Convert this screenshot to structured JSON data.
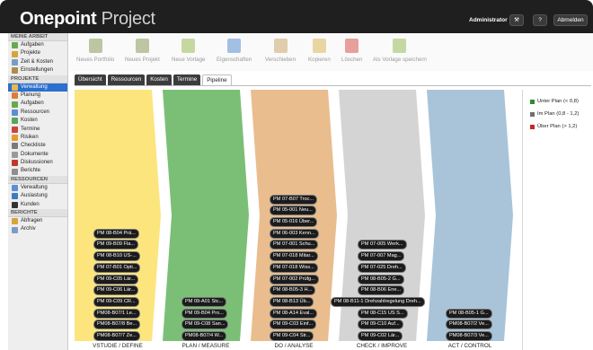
{
  "header": {
    "logo_bold": "Onepoint",
    "logo_light": " Project",
    "user": "Administrator",
    "btn_tools": "⚒",
    "btn_help": "?",
    "btn_logout": "Abmelden"
  },
  "sidebar": {
    "sections": [
      {
        "title": "MEINE ARBEIT",
        "items": [
          {
            "label": "Aufgaben",
            "icon": "tasks-icon",
            "color": "#6aa84f"
          },
          {
            "label": "Projekte",
            "icon": "projects-icon",
            "color": "#d8a43a"
          },
          {
            "label": "Zeit & Kosten",
            "icon": "time-costs-icon",
            "color": "#7a9cc6"
          },
          {
            "label": "Einstellungen",
            "icon": "settings-icon",
            "color": "#b08b4f"
          }
        ]
      },
      {
        "title": "PROJEKTE",
        "items": [
          {
            "label": "Verwaltung",
            "icon": "admin-icon",
            "color": "#e9b949",
            "active": true
          },
          {
            "label": "Planung",
            "icon": "planning-icon",
            "color": "#e07b39"
          },
          {
            "label": "Aufgaben",
            "icon": "tasks-icon",
            "color": "#6aa84f"
          },
          {
            "label": "Ressourcen",
            "icon": "resources-icon",
            "color": "#5b8fd1"
          },
          {
            "label": "Kosten",
            "icon": "costs-icon",
            "color": "#58a55c"
          },
          {
            "label": "Termine",
            "icon": "calendar-icon",
            "color": "#c9463d"
          },
          {
            "label": "Risiken",
            "icon": "risks-icon",
            "color": "#e59a2f"
          },
          {
            "label": "Checkliste",
            "icon": "checklist-icon",
            "color": "#7a7a7a"
          },
          {
            "label": "Dokumente",
            "icon": "documents-icon",
            "color": "#9a9a9a"
          },
          {
            "label": "Diskussionen",
            "icon": "discussions-icon",
            "color": "#c0392b"
          },
          {
            "label": "Berichte",
            "icon": "reports-icon",
            "color": "#8e8e8e"
          }
        ]
      },
      {
        "title": "RESSOURCEN",
        "items": [
          {
            "label": "Verwaltung",
            "icon": "resource-admin-icon",
            "color": "#5b8fd1"
          },
          {
            "label": "Auslastung",
            "icon": "utilization-icon",
            "color": "#3e7cc2"
          },
          {
            "label": "Kunden",
            "icon": "customers-icon",
            "color": "#333333"
          }
        ]
      },
      {
        "title": "BERICHTE",
        "items": [
          {
            "label": "Abfragen",
            "icon": "queries-icon",
            "color": "#d8a43a"
          },
          {
            "label": "Archiv",
            "icon": "archive-icon",
            "color": "#7a9cc6"
          }
        ]
      }
    ]
  },
  "toolbar": [
    {
      "label": "Neues Portfolio",
      "icon": "new-portfolio-icon",
      "color": "#8a9a5b"
    },
    {
      "label": "Neues Projekt",
      "icon": "new-project-icon",
      "color": "#8a9a5b"
    },
    {
      "label": "Neue Vorlage",
      "icon": "new-template-icon",
      "color": "#9bbb59"
    },
    {
      "label": "Eigenschaften",
      "icon": "properties-icon",
      "color": "#5b8fd1"
    },
    {
      "label": "Verschieben",
      "icon": "move-icon",
      "color": "#c8a86a"
    },
    {
      "label": "Kopieren",
      "icon": "copy-icon",
      "color": "#d8b65a"
    },
    {
      "label": "Löschen",
      "icon": "delete-icon",
      "color": "#d9534f"
    },
    {
      "label": "Als Vorlage speichern",
      "icon": "save-template-icon",
      "color": "#9bbb59"
    }
  ],
  "tabs": [
    {
      "label": "Übersicht"
    },
    {
      "label": "Ressourcen"
    },
    {
      "label": "Kosten"
    },
    {
      "label": "Termine"
    },
    {
      "label": "Pipeline",
      "active": true
    }
  ],
  "pipeline": {
    "stages": [
      {
        "label": "VSTUDIE / DEFINE",
        "color": "#fde57d",
        "cards": [
          "PM 08-B04 Prä...",
          "PM 09-B09 Fla...",
          "PM 08-B10 US-...",
          "PM 07-B01 Opti...",
          "PM 09-C05 Lär...",
          "PM 09-C06 Lär...",
          "PM 09-C09 CR...",
          "PM08-B07/1 Le...",
          "PM08-B07/8 Be...",
          "PM08-B07/7 Ze..."
        ]
      },
      {
        "label": "PLAN / MEASURE",
        "color": "#7bbf76",
        "cards": [
          "PM 09-A01 Stc...",
          "PM 09-B04 Pro...",
          "PM 09-C08 San...",
          "PM08-B07/4 W..."
        ]
      },
      {
        "label": "DO / ANALYSE",
        "color": "#e9bd8e",
        "cards": [
          "PM 07-B07 Troc...",
          "PM 05-001 Neu...",
          "PM 05-016 Über...",
          "PM 06-003 Kenn...",
          "PM 07-001 Schu...",
          "PM 07-018 Mitar...",
          "PM 07-018 Wiss...",
          "PM 07-002 Prüfg...",
          "PM 08-B05-3 H...",
          "PM 08-B13 Üb...",
          "PM 08-A14 Eval...",
          "PM 09-C03 Einf...",
          "PM 09-C04 Str..."
        ]
      },
      {
        "label": "CHECK / IMPROVE",
        "color": "#d4d4d4",
        "cards": [
          "PM 07-005 Werk...",
          "PM 07-007 Mag...",
          "PM 07-025 Dreh...",
          "PM 08-B05-2 G...",
          "PM 08-B06 Ene...",
          "PM 08-B11-1 Drehzahlregelung Dreh...",
          "PM 08-C15 US S...",
          "PM 09-C10 Auf...",
          "PM 09-C02 Lär..."
        ]
      },
      {
        "label": "ACT / CONTROL",
        "color": "#a9c4d9",
        "cards": [
          "PM 08-B05-1 G...",
          "PM08-B07/2 Ve...",
          "PM08-B07/3 Ve..."
        ]
      }
    ]
  },
  "legend": [
    {
      "label": "Unter Plan (< 0,8)",
      "color": "#2e8b2e"
    },
    {
      "label": "Im Plan (0,8 - 1,2)",
      "color": "#6f6f6f"
    },
    {
      "label": "Über Plan (> 1,2)",
      "color": "#c62828"
    }
  ]
}
